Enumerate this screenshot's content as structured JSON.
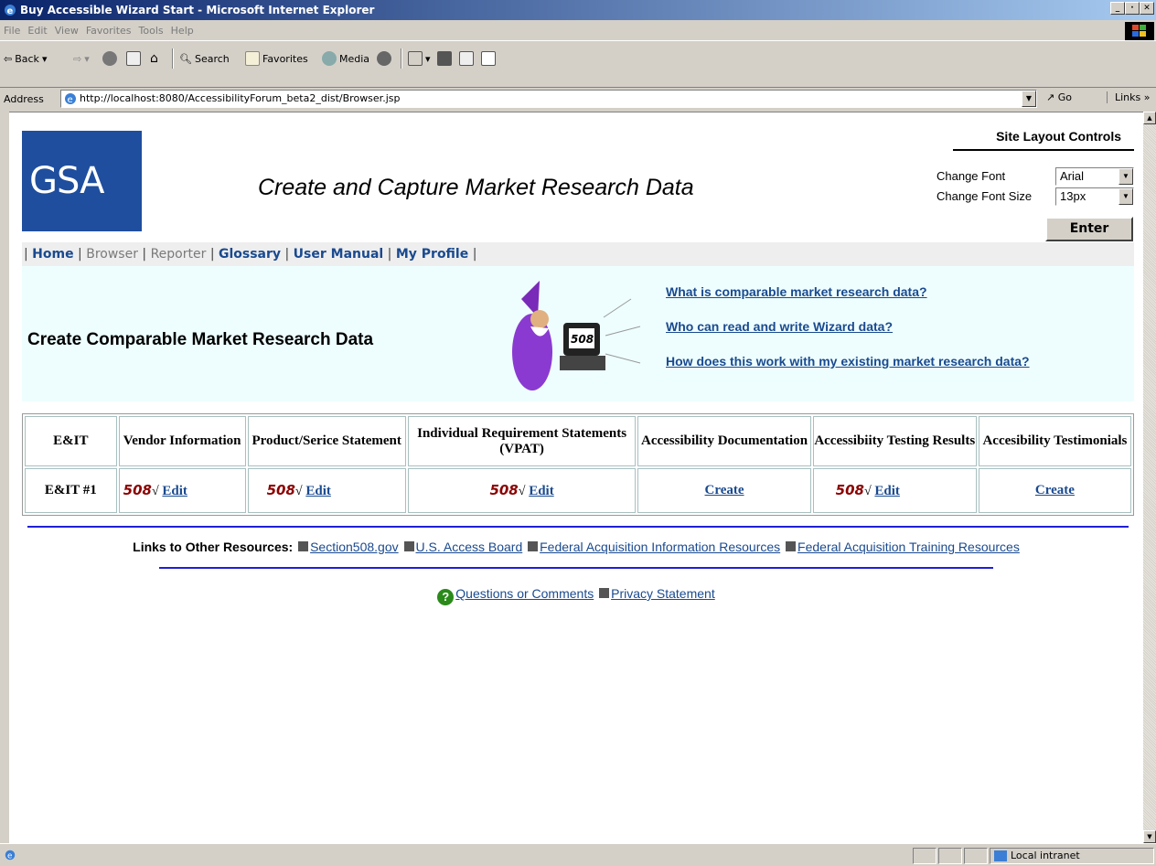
{
  "window": {
    "title": "Buy Accessible Wizard Start - Microsoft Internet Explorer",
    "buttons": [
      "_",
      "·",
      "✕"
    ]
  },
  "menu": [
    "File",
    "Edit",
    "View",
    "Favorites",
    "Tools",
    "Help"
  ],
  "toolbar": {
    "back": "Back",
    "search": "Search",
    "favorites": "Favorites",
    "media": "Media"
  },
  "address": {
    "label": "Address",
    "url": "http://localhost:8080/AccessibilityForum_beta2_dist/Browser.jsp",
    "go": "Go",
    "links": "Links"
  },
  "status": {
    "zone": "Local intranet"
  },
  "page": {
    "logo_text": "GSA",
    "title": "Create and Capture Market Research Data",
    "layout_controls": {
      "heading": "Site Layout Controls",
      "font_label": "Change Font",
      "font_value": "Arial",
      "size_label": "Change Font Size",
      "size_value": "13px",
      "enter": "Enter"
    },
    "nav": {
      "home": "Home",
      "browser": "Browser",
      "reporter": "Reporter",
      "glossary": "Glossary",
      "manual": "User Manual",
      "profile": "My Profile"
    },
    "banner": {
      "heading": "Create Comparable Market Research Data",
      "links": [
        "What is comparable market research data?",
        "Who can read and write Wizard data?",
        "How does this work with my existing market research data?"
      ]
    },
    "grid": {
      "headers": [
        "E&IT",
        "Vendor Information",
        "Product/Serice Statement",
        "Individual Requirement Statements (VPAT)",
        "Accessibility Documentation",
        "Accessibiity Testing Results",
        "Accesibility Testimonials"
      ],
      "row_label": "E&IT #1",
      "mark": "508",
      "check": "√",
      "edit": "Edit",
      "create": "Create"
    },
    "resources": {
      "label": "Links to Other Resources:",
      "links": [
        "Section508.gov",
        "U.S. Access Board",
        "Federal Acquisition Information Resources",
        "Federal Acquisition Training Resources"
      ]
    },
    "footer": {
      "questions": "Questions or Comments",
      "privacy": "Privacy Statement"
    }
  }
}
